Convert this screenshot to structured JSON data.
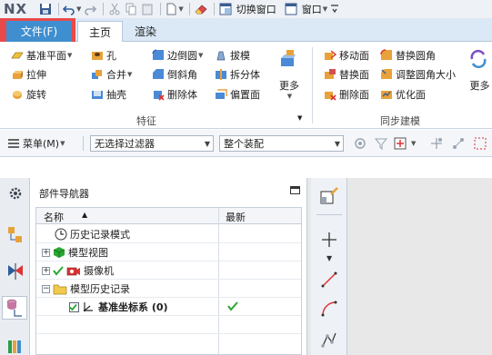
{
  "app": {
    "logo": "NX"
  },
  "quick_access": {
    "switch_window_label": "切换窗口",
    "window_label": "窗口"
  },
  "tabs": {
    "file_label": "文件(F)",
    "items": [
      {
        "label": "主页"
      },
      {
        "label": "渲染"
      }
    ]
  },
  "ribbon": {
    "buttons": {
      "datum_plane": "基准平面",
      "hole": "孔",
      "edge_blend": "边倒圆",
      "draft": "拔模",
      "extrude": "拉伸",
      "unite": "合并",
      "chamfer": "倒斜角",
      "split_body": "拆分体",
      "revolve": "旋转",
      "shell": "抽壳",
      "delete_body": "删除体",
      "offset_face": "偏置面",
      "more_feature": "更多",
      "move_face": "移动面",
      "replace_blend": "替换圆角",
      "replace_face": "替换面",
      "resize_blend": "调整圆角大小",
      "delete_face": "删除面",
      "optimize_face": "优化面",
      "more_sync": "更多"
    },
    "groups": {
      "feature": "特征",
      "sync": "同步建模"
    }
  },
  "selection_bar": {
    "menu_label": "菜单(M)",
    "filter_value": "无选择过滤器",
    "scope_value": "整个装配"
  },
  "navigator": {
    "title": "部件导航器",
    "columns": {
      "name": "名称",
      "latest": "最新"
    },
    "rows": [
      {
        "label": "历史记录模式"
      },
      {
        "label": "模型视图"
      },
      {
        "label": "摄像机"
      },
      {
        "label": "模型历史记录"
      },
      {
        "label": "基准坐标系 (0)"
      }
    ]
  },
  "colors": {
    "file_tab_bg": "#3f8fd0",
    "file_highlight": "#e74a4a",
    "ribbon_tab_bar": "#dbe8f5",
    "check_green": "#2aa832"
  }
}
